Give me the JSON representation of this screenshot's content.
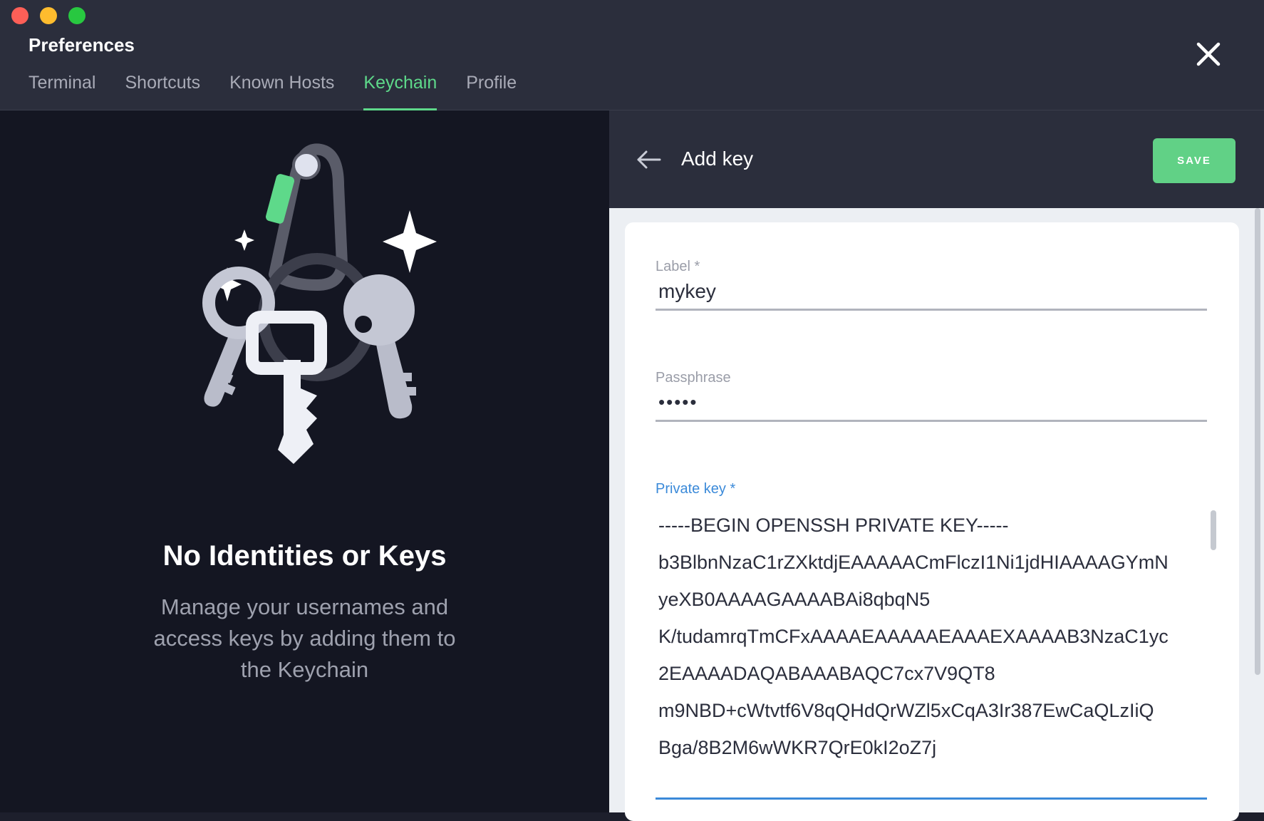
{
  "window": {
    "title": "Preferences"
  },
  "tabs": [
    {
      "label": "Terminal",
      "active": false
    },
    {
      "label": "Shortcuts",
      "active": false
    },
    {
      "label": "Known Hosts",
      "active": false
    },
    {
      "label": "Keychain",
      "active": true
    },
    {
      "label": "Profile",
      "active": false
    }
  ],
  "empty_state": {
    "title": "No Identities or Keys",
    "description": "Manage your usernames and access keys by adding them to the Keychain"
  },
  "add_key": {
    "title": "Add key",
    "save_label": "SAVE",
    "label_field": {
      "label": "Label *",
      "value": "mykey"
    },
    "passphrase_field": {
      "label": "Passphrase",
      "value": "•••••"
    },
    "private_key_field": {
      "label": "Private key *",
      "lines": [
        "-----BEGIN OPENSSH PRIVATE KEY-----",
        "b3BlbnNzaC1rZXktdjEAAAAACmFlczI1Ni1jdHIAAAAGYmN",
        "yeXB0AAAAGAAAABAi8qbqN5",
        "K/tudamrqTmCFxAAAAEAAAAAEAAAEXAAAAB3NzaC1yc",
        "2EAAAADAQABAAABAQC7cx7V9QT8",
        "m9NBD+cWtvtf6V8qQHdQrWZl5xCqA3Ir387EwCaQLzIiQ",
        "Bga/8B2M6wWKR7QrE0kI2oZ7j"
      ]
    }
  },
  "icons": {
    "close": "close-icon",
    "back": "arrow-left-icon"
  },
  "colors": {
    "accent": "#5ed98a",
    "save_button": "#61d186",
    "focus": "#3b8ad9",
    "header_bg": "#2b2e3c",
    "panel_bg": "#141622"
  }
}
